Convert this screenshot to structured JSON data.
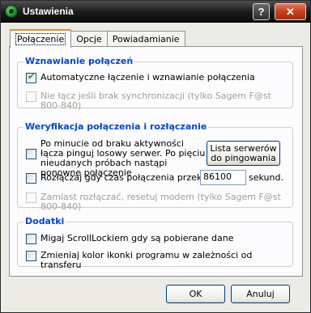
{
  "window": {
    "title": "Ustawienia"
  },
  "titlebar": {
    "help_label": "?",
    "close_label": "✕"
  },
  "tabs": [
    {
      "label": "Połączenie",
      "active": true
    },
    {
      "label": "Opcje",
      "active": false
    },
    {
      "label": "Powiadamianie",
      "active": false
    }
  ],
  "group_resume": {
    "title": "Wznawianie połączeń",
    "auto_reconnect": {
      "label": "Automatyczne łączenie i wznawianie połączenia",
      "checked": true
    },
    "no_connect_sync": {
      "label": "Nie łącz jeśli brak synchronizacji (tylko Sagem F@st 800-840)",
      "checked": false,
      "disabled": true
    }
  },
  "group_verify": {
    "title": "Weryfikacja połączenia i rozłączanie",
    "ping_check": {
      "label": "Po minucie od braku aktywności łącza pinguj losowy serwer. Po pięciu nieudanych próbach nastąpi ponowne połączenie",
      "checked": false
    },
    "server_list_button": "Lista serwerów do pingowania",
    "disconnect_after": {
      "label": "Rozłączaj gdy czas połączenia przekroczy",
      "checked": false,
      "value": "86100",
      "unit": "sekund."
    },
    "reset_modem": {
      "label": "Zamiast rozłączać, resetuj modem (tylko Sagem F@st 800-840)",
      "checked": false,
      "disabled": true
    }
  },
  "group_extras": {
    "title": "Dodatki",
    "scroll_lock": {
      "label": "Migaj ScrollLockiem gdy są pobierane dane",
      "checked": false
    },
    "icon_color": {
      "label": "Zmieniaj kolor ikonki programu w zależności od transferu",
      "checked": false
    }
  },
  "footer": {
    "ok_label": "OK",
    "cancel_label": "Anuluj"
  }
}
